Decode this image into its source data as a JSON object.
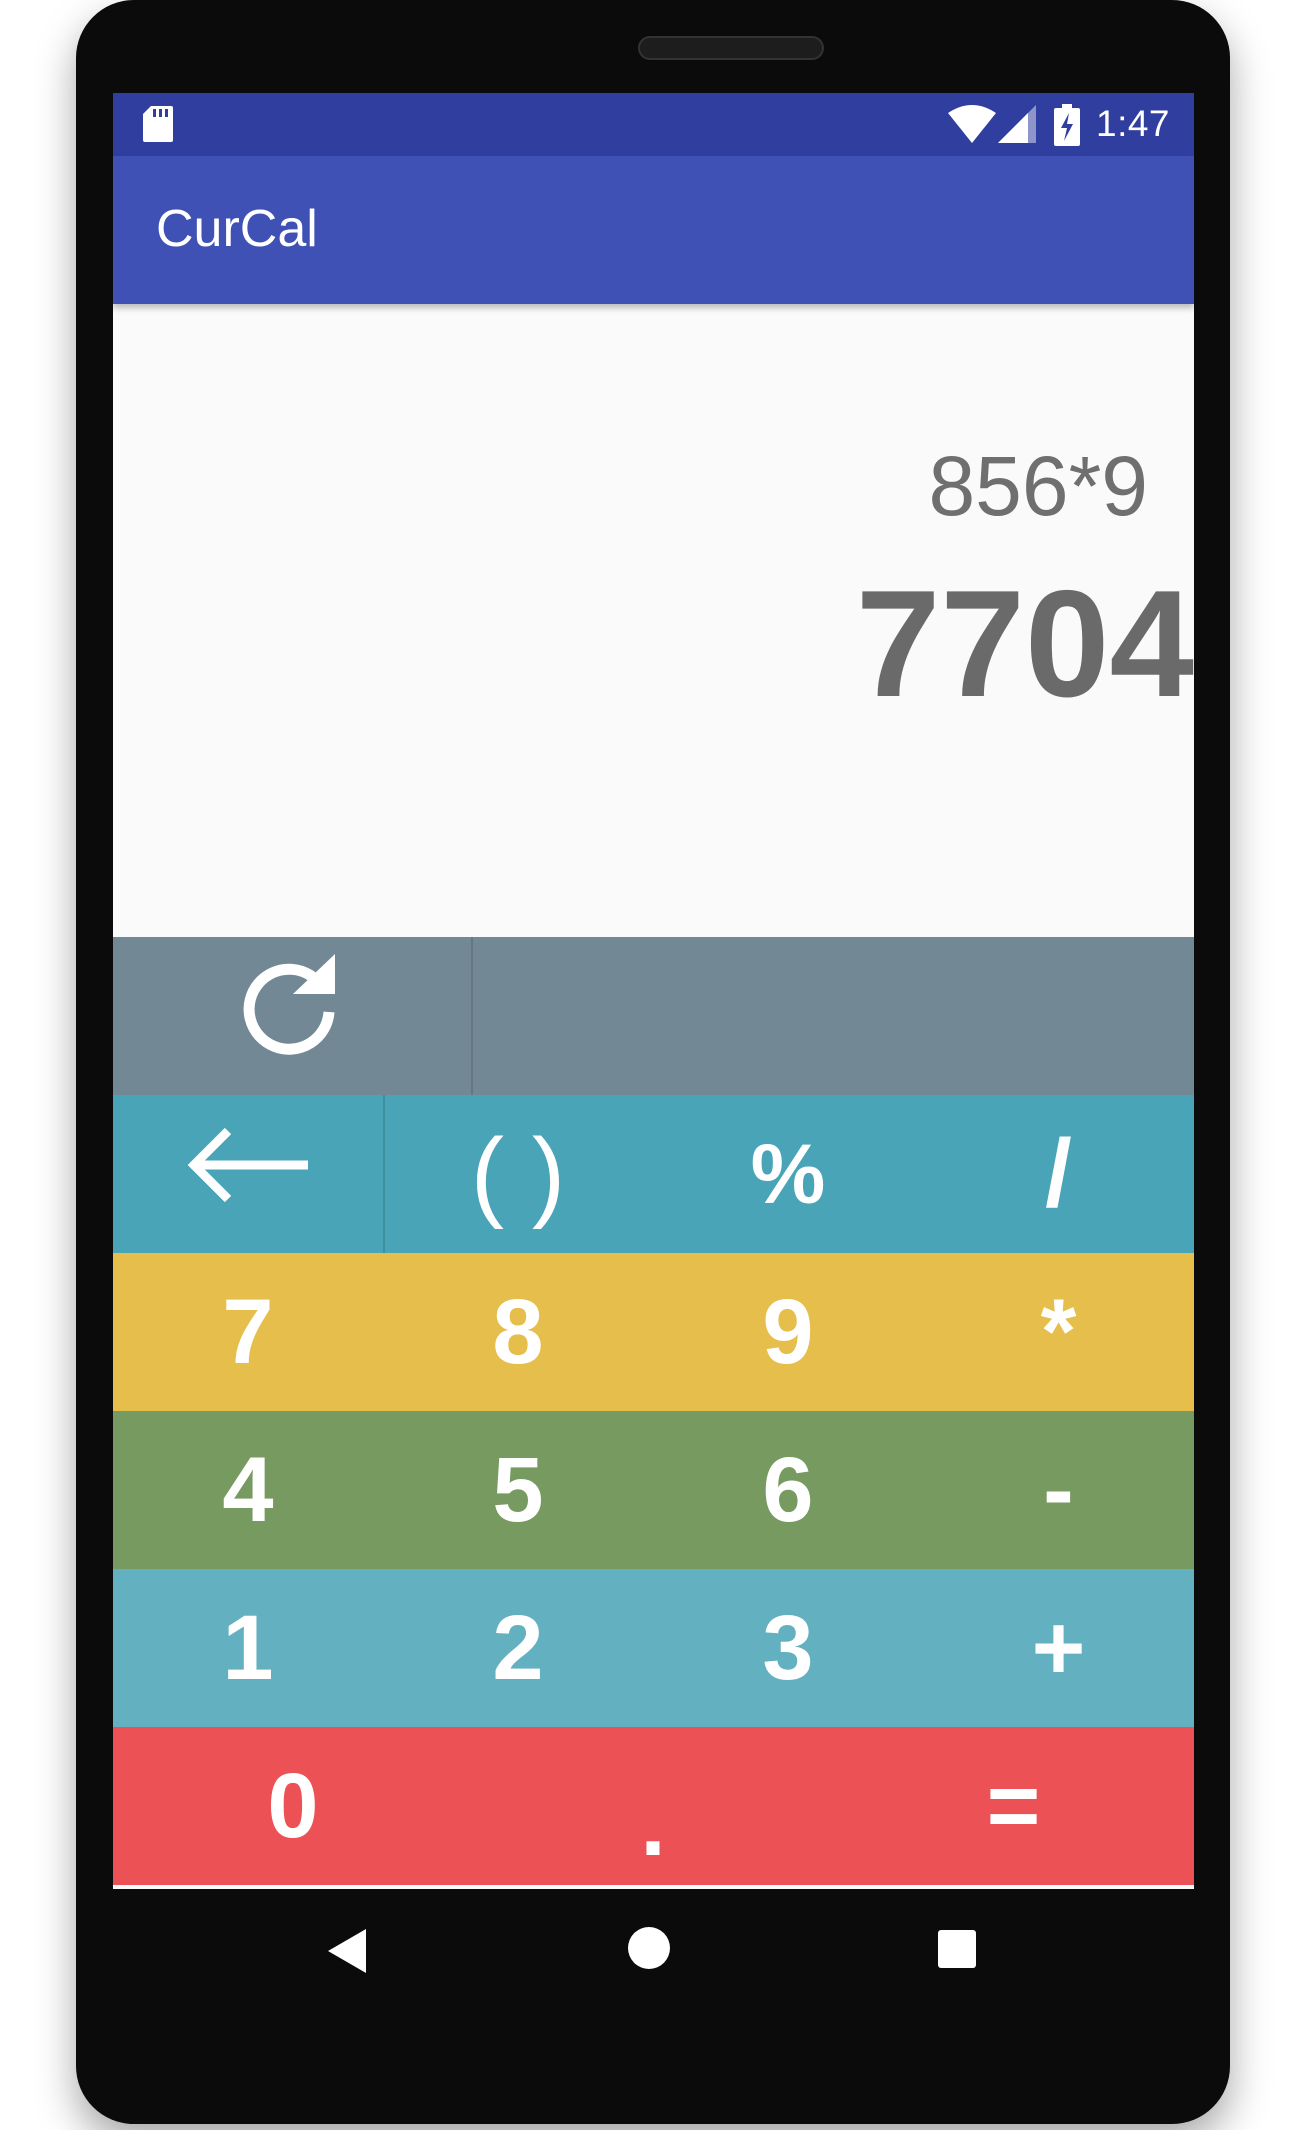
{
  "status_bar": {
    "time": "1:47",
    "icons": [
      "sd-card-icon",
      "wifi-icon",
      "cell-signal-icon",
      "battery-charging-icon"
    ]
  },
  "app_bar": {
    "title": "CurCal"
  },
  "display": {
    "expression": "856*9",
    "result": "7704"
  },
  "keypad": {
    "row0": {
      "refresh_icon": "refresh-icon"
    },
    "row1": {
      "backspace_icon": "backspace-arrow-icon",
      "parens": "( )",
      "percent": "%",
      "divide": "/"
    },
    "row2": {
      "k7": "7",
      "k8": "8",
      "k9": "9",
      "multiply": "*"
    },
    "row3": {
      "k4": "4",
      "k5": "5",
      "k6": "6",
      "minus": "-"
    },
    "row4": {
      "k1": "1",
      "k2": "2",
      "k3": "3",
      "plus": "+"
    },
    "row5": {
      "k0": "0",
      "dot": ".",
      "equals": "="
    },
    "colors": {
      "row0": "#728894",
      "row1": "#48a4b6",
      "row2": "#e6be4b",
      "row3": "#779a60",
      "row4": "#62b0c0",
      "row5": "#ec5255"
    }
  },
  "nav_bar": {
    "icons": [
      "back-icon",
      "home-icon",
      "recents-icon"
    ]
  },
  "theme": {
    "status_bar": "#303f9f",
    "app_bar": "#3f51b5",
    "display_bg": "#fafafa",
    "display_text": "#6f6f6f"
  }
}
